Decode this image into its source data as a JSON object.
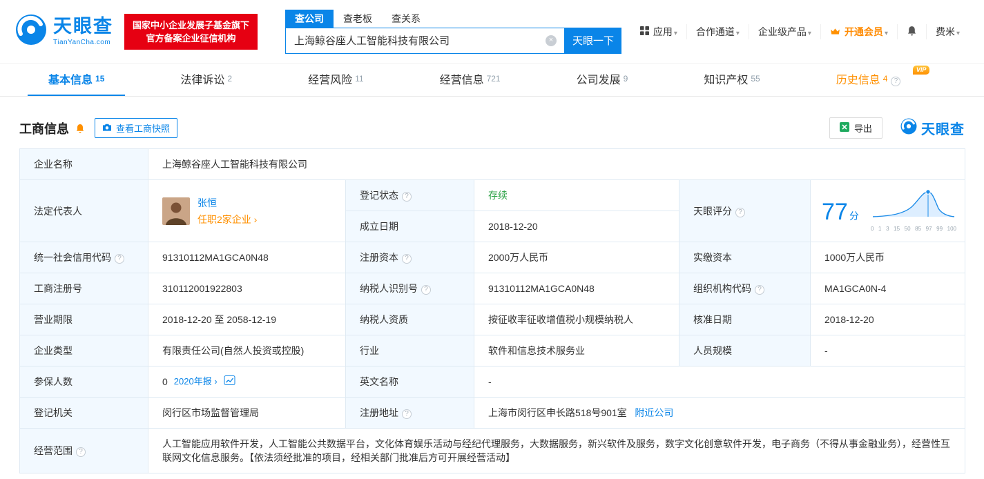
{
  "brand": {
    "name": "天眼查",
    "domain": "TianYanCha.com",
    "badge_line1": "国家中小企业发展子基金旗下",
    "badge_line2": "官方备案企业征信机构"
  },
  "search": {
    "tab_company": "查公司",
    "tab_boss": "查老板",
    "tab_relation": "查关系",
    "value": "上海鲸谷座人工智能科技有限公司",
    "button": "天眼一下"
  },
  "nav": {
    "apps": "应用",
    "cooperation": "合作通道",
    "enterprise": "企业级产品",
    "vip": "开通会员",
    "user": "费米"
  },
  "tabs": {
    "basic": {
      "label": "基本信息",
      "count": "15"
    },
    "legal": {
      "label": "法律诉讼",
      "count": "2"
    },
    "risk": {
      "label": "经营风险",
      "count": "11"
    },
    "operation": {
      "label": "经营信息",
      "count": "721"
    },
    "development": {
      "label": "公司发展",
      "count": "9"
    },
    "ip": {
      "label": "知识产权",
      "count": "55"
    },
    "history": {
      "label": "历史信息",
      "count": "4",
      "vip": "VIP"
    }
  },
  "section": {
    "title": "工商信息",
    "snapshot": "查看工商快照",
    "export": "导出",
    "logo": "天眼查"
  },
  "score": {
    "label": "天眼评分",
    "value": "77",
    "unit": "分",
    "axis": [
      "0",
      "1",
      "3",
      "15",
      "50",
      "85",
      "97",
      "99",
      "100"
    ]
  },
  "fields": {
    "company_name": {
      "label": "企业名称",
      "value": "上海鲸谷座人工智能科技有限公司"
    },
    "legal_rep": {
      "label": "法定代表人",
      "name": "张恒",
      "positions": "任职2家企业 ›"
    },
    "reg_status": {
      "label": "登记状态",
      "value": "存续"
    },
    "est_date": {
      "label": "成立日期",
      "value": "2018-12-20"
    },
    "credit_code": {
      "label": "统一社会信用代码",
      "value": "91310112MA1GCA0N48"
    },
    "reg_capital": {
      "label": "注册资本",
      "value": "2000万人民币"
    },
    "paid_capital": {
      "label": "实缴资本",
      "value": "1000万人民币"
    },
    "reg_number": {
      "label": "工商注册号",
      "value": "310112001922803"
    },
    "taxpayer_id": {
      "label": "纳税人识别号",
      "value": "91310112MA1GCA0N48"
    },
    "org_code": {
      "label": "组织机构代码",
      "value": "MA1GCA0N-4"
    },
    "term": {
      "label": "营业期限",
      "value": "2018-12-20 至 2058-12-19"
    },
    "taxpayer_quality": {
      "label": "纳税人资质",
      "value": "按征收率征收增值税小规模纳税人"
    },
    "approval_date": {
      "label": "核准日期",
      "value": "2018-12-20"
    },
    "company_type": {
      "label": "企业类型",
      "value": "有限责任公司(自然人投资或控股)"
    },
    "industry": {
      "label": "行业",
      "value": "软件和信息技术服务业"
    },
    "staff": {
      "label": "人员规模",
      "value": "-"
    },
    "insured": {
      "label": "参保人数",
      "value": "0",
      "report": "2020年报 ›"
    },
    "english_name": {
      "label": "英文名称",
      "value": "-"
    },
    "authority": {
      "label": "登记机关",
      "value": "闵行区市场监督管理局"
    },
    "address": {
      "label": "注册地址",
      "value": "上海市闵行区申长路518号901室",
      "nearby": "附近公司"
    },
    "scope": {
      "label": "经营范围",
      "value": "人工智能应用软件开发，人工智能公共数据平台，文化体育娱乐活动与经纪代理服务，大数据服务，新兴软件及服务，数字文化创意软件开发，电子商务（不得从事金融业务），经营性互联网文化信息服务。【依法须经批准的项目，经相关部门批准后方可开展经营活动】"
    }
  }
}
